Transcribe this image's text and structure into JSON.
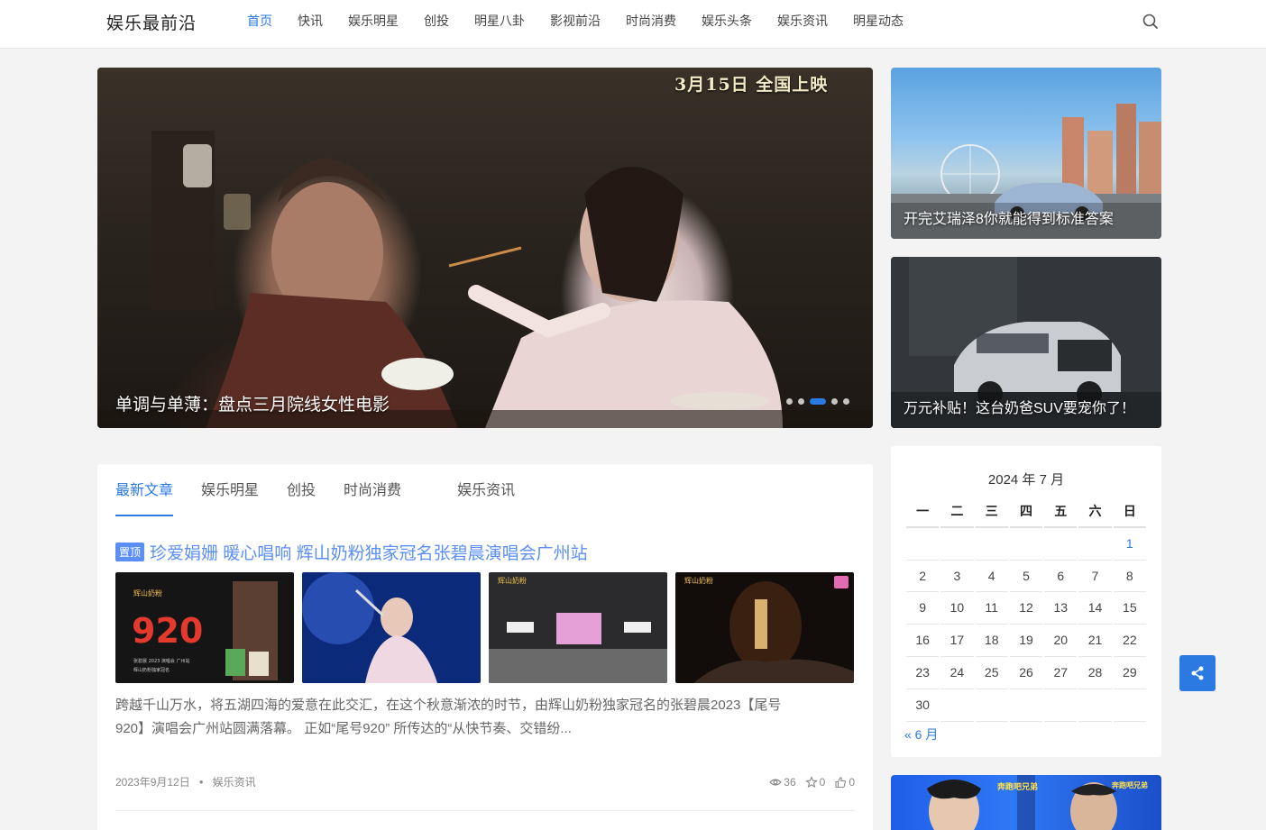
{
  "header": {
    "logo": "娱乐最前沿",
    "nav": [
      "首页",
      "快讯",
      "娱乐明星",
      "创投",
      "明星八卦",
      "影视前沿",
      "时尚消费",
      "娱乐头条",
      "娱乐资讯",
      "明星动态"
    ],
    "active_nav": "首页",
    "search_icon": "search-icon"
  },
  "slider": {
    "badge": "3月15日 全国上映",
    "caption": "单调与单薄：盘点三月院线女性电影",
    "dots_total": 5,
    "active_dot": 3
  },
  "side_cards": [
    {
      "caption": "开完艾瑞泽8你就能得到标准答案"
    },
    {
      "caption": "万元补贴！这台奶爸SUV要宠你了！"
    }
  ],
  "articles": {
    "tabs": [
      "最新文章",
      "娱乐明星",
      "创投",
      "时尚消费",
      "",
      "娱乐资讯"
    ],
    "active_tab": "最新文章",
    "post": {
      "pin_label": "置顶",
      "title": "珍爱娟姗 暖心唱响 辉山奶粉独家冠名张碧晨演唱会广州站",
      "thumb_texts": [
        "辉山奶粉",
        "920",
        "张碧晨 2023 演唱会 广州站",
        "辉山奶粉独家冠名",
        "辉山奶粉",
        "辉山奶粉"
      ],
      "excerpt_line1": "跨越千山万水，将五湖四海的爱意在此交汇，在这个秋意渐浓的时节，由辉山奶粉独家冠名的张碧晨2023【尾号",
      "excerpt_line2": "920】演唱会广州站圆满落幕。 正如“尾号920” 所传达的“从快节奏、交错纷...",
      "date": "2023年9月12日",
      "category": "娱乐资讯",
      "views": "36",
      "stars": "0",
      "likes": "0"
    }
  },
  "calendar": {
    "caption": "2024 年 7 月",
    "weekdays": [
      "一",
      "二",
      "三",
      "四",
      "五",
      "六",
      "日"
    ],
    "weeks": [
      [
        "",
        "",
        "",
        "",
        "",
        "",
        "1"
      ],
      [
        "2",
        "3",
        "4",
        "5",
        "6",
        "7",
        "8"
      ],
      [
        "9",
        "10",
        "11",
        "12",
        "13",
        "14",
        "15"
      ],
      [
        "16",
        "17",
        "18",
        "19",
        "20",
        "21",
        "22"
      ],
      [
        "23",
        "24",
        "25",
        "26",
        "27",
        "28",
        "29"
      ],
      [
        "30",
        "",
        "",
        "",
        "",
        "",
        ""
      ]
    ],
    "prev_link": "« 6 月"
  },
  "bottom_card": {
    "badge_left": "奔跑吧兄弟",
    "badge_right": "奔跑吧兄弟"
  },
  "colors": {
    "accent": "#2a7ae2",
    "title_link": "#5b8ff5"
  },
  "share_icon": "share-icon"
}
